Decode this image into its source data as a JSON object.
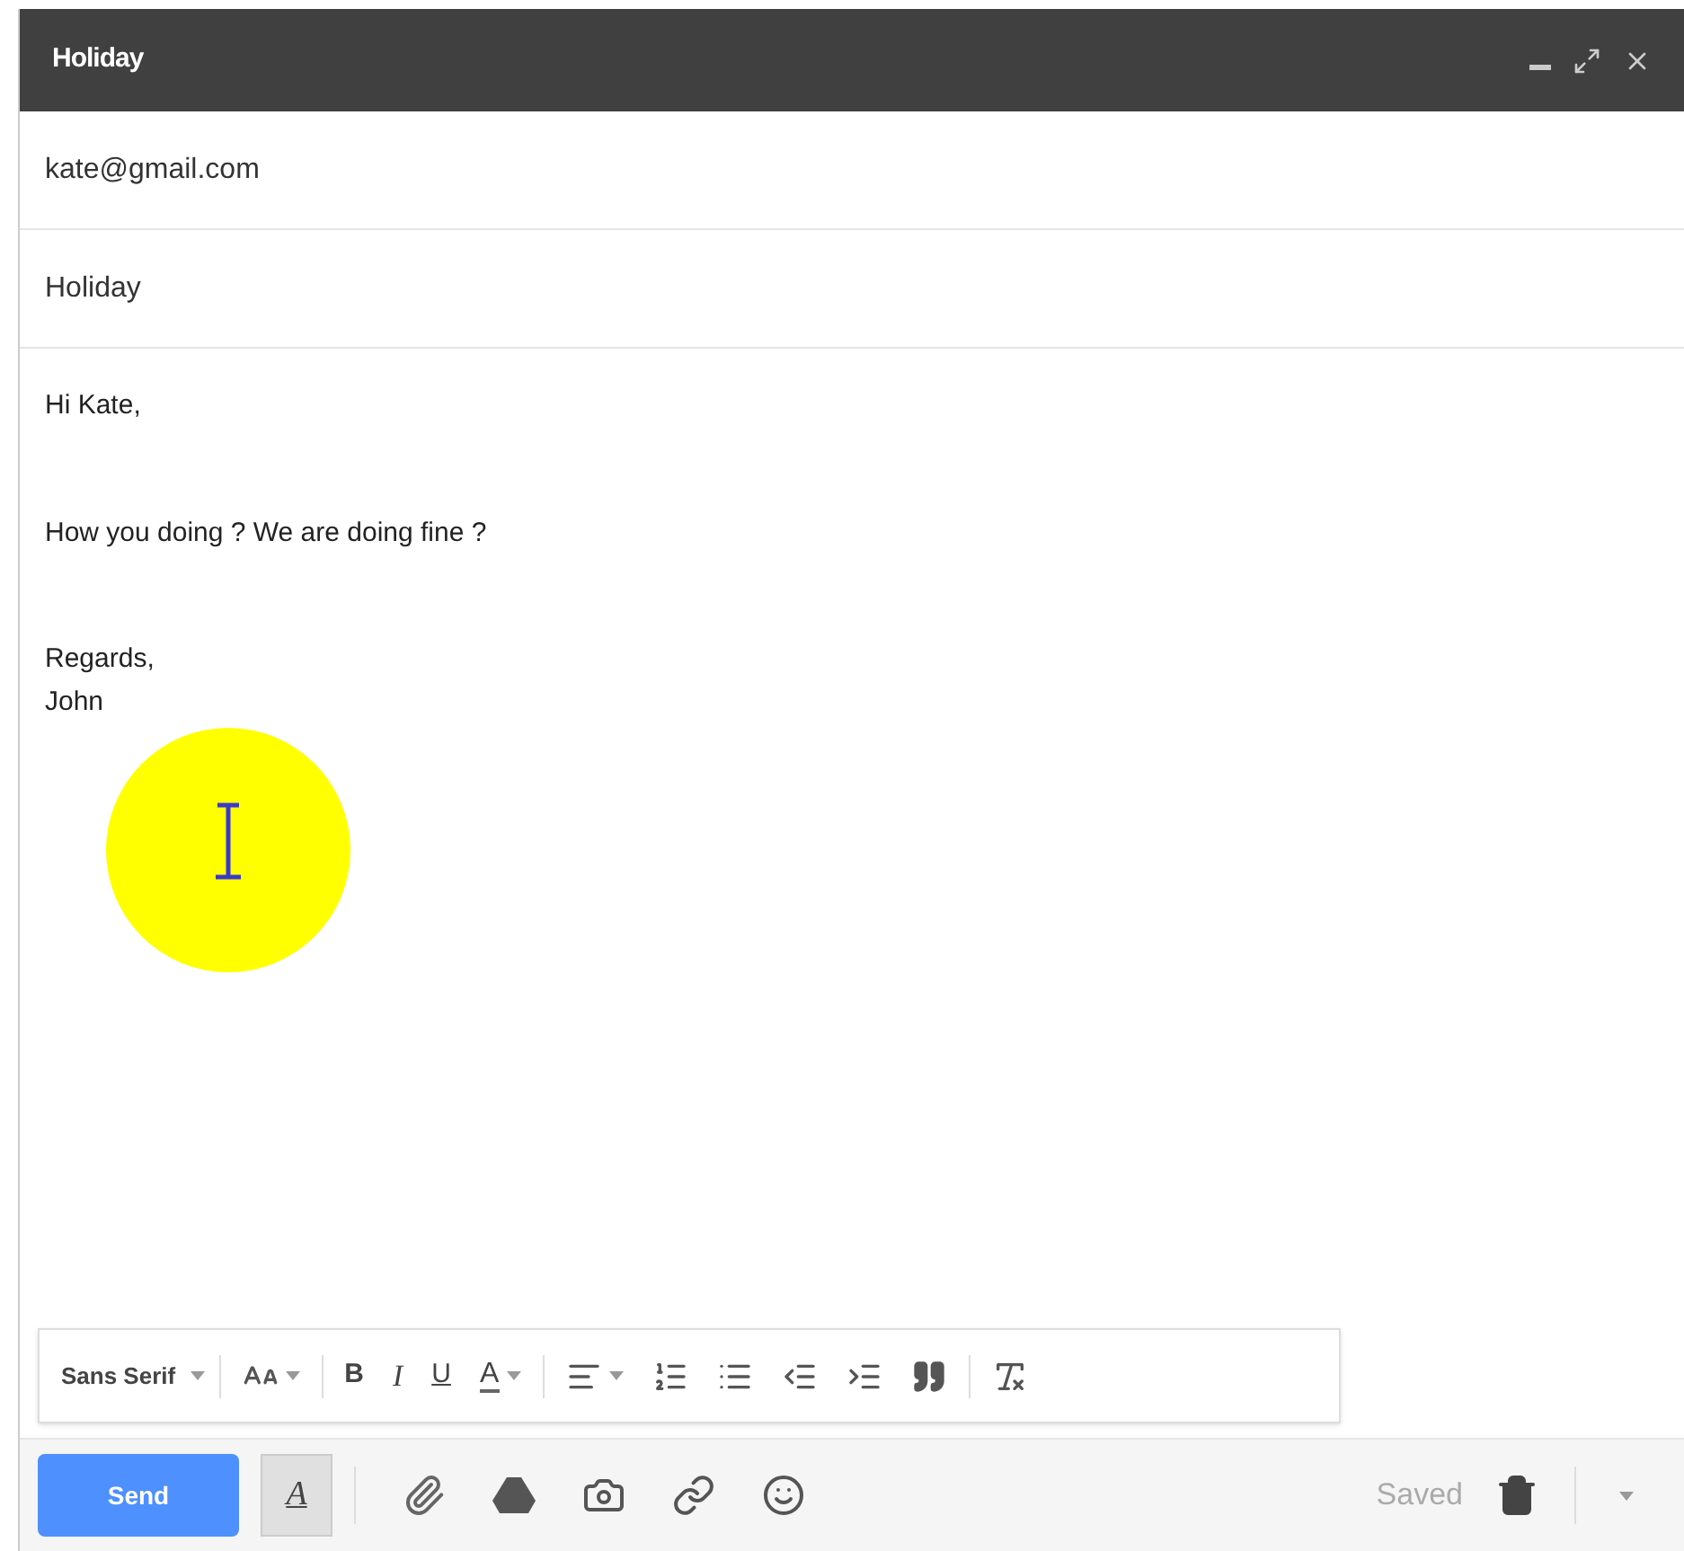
{
  "window": {
    "title": "Holiday"
  },
  "to": {
    "value": "kate@gmail.com"
  },
  "subject": {
    "value": "Holiday"
  },
  "body": {
    "paragraphs": [
      [
        "Hi Kate,"
      ],
      [
        "How you doing ? We are doing fine ?"
      ],
      [
        "Regards,",
        "John"
      ]
    ]
  },
  "format_toolbar": {
    "font": "Sans Serif",
    "buttons": [
      {
        "kind": "size"
      },
      {
        "kind": "bold",
        "label": "B"
      },
      {
        "kind": "italic",
        "label": "I"
      },
      {
        "kind": "underline",
        "label": "U"
      },
      {
        "kind": "text-color",
        "label": "A"
      },
      {
        "kind": "align"
      },
      {
        "kind": "numbered-list"
      },
      {
        "kind": "bulleted-list"
      },
      {
        "kind": "indent-less"
      },
      {
        "kind": "indent-more"
      },
      {
        "kind": "quote"
      },
      {
        "kind": "remove-formatting"
      }
    ]
  },
  "bottom_bar": {
    "send": "Send",
    "formatting": {
      "label": "A",
      "selected": true
    },
    "status": "Saved"
  }
}
